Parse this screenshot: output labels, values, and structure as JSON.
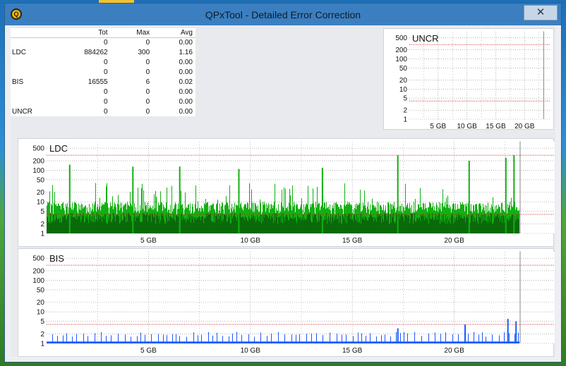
{
  "window": {
    "title": "QPxTool - Detailed Error Correction",
    "close_glyph": "✕",
    "icon_letter": "Q"
  },
  "stats": {
    "headers": [
      "",
      "Tot",
      "Max",
      "Avg"
    ],
    "rows": [
      [
        "",
        "0",
        "0",
        "0.00"
      ],
      [
        "LDC",
        "884262",
        "300",
        "1.16"
      ],
      [
        "",
        "0",
        "0",
        "0.00"
      ],
      [
        "",
        "0",
        "0",
        "0.00"
      ],
      [
        "BIS",
        "16555",
        "6",
        "0.02"
      ],
      [
        "",
        "0",
        "0",
        "0.00"
      ],
      [
        "",
        "0",
        "0",
        "0.00"
      ],
      [
        "UNCR",
        "0",
        "0",
        "0.00"
      ]
    ]
  },
  "chart_data": [
    {
      "type": "bar",
      "title": "UNCR",
      "y_scale": "log",
      "y_ticks": [
        "500",
        "200",
        "100",
        "50",
        "20",
        "10",
        "5",
        "2",
        "1"
      ],
      "x_ticks": [
        "5 GB",
        "10 GB",
        "15 GB",
        "20 GB"
      ],
      "x_range": [
        0,
        23.2
      ],
      "threshold_lines": [
        300,
        4
      ],
      "grid": true,
      "values": []
    },
    {
      "type": "bar",
      "title": "LDC",
      "y_scale": "log",
      "y_ticks": [
        "500",
        "200",
        "100",
        "50",
        "20",
        "10",
        "5",
        "2",
        "1"
      ],
      "x_ticks": [
        "5 GB",
        "10 GB",
        "15 GB",
        "20 GB"
      ],
      "x_range": [
        0,
        23.2
      ],
      "threshold_lines": [
        300,
        4
      ],
      "grid": true,
      "series": [
        {
          "name": "LDC",
          "color": "#12b012"
        }
      ],
      "peaks": [
        {
          "x": 1.1,
          "y": 150
        },
        {
          "x": 4.2,
          "y": 130
        },
        {
          "x": 6.5,
          "y": 130
        },
        {
          "x": 9.4,
          "y": 110
        },
        {
          "x": 13.5,
          "y": 120
        },
        {
          "x": 17.2,
          "y": 300
        },
        {
          "x": 20.7,
          "y": 200
        },
        {
          "x": 22.5,
          "y": 250
        },
        {
          "x": 22.9,
          "y": 300
        }
      ]
    },
    {
      "type": "bar",
      "title": "BIS",
      "y_scale": "log",
      "y_ticks": [
        "500",
        "200",
        "100",
        "50",
        "20",
        "10",
        "5",
        "2",
        "1"
      ],
      "x_ticks": [
        "5 GB",
        "10 GB",
        "15 GB",
        "20 GB"
      ],
      "x_range": [
        0,
        23.2
      ],
      "threshold_lines": [
        300,
        4
      ],
      "grid": true,
      "series": [
        {
          "name": "BIS",
          "color": "#1a5aff"
        }
      ],
      "peaks": [
        {
          "x": 17.2,
          "y": 3
        },
        {
          "x": 20.5,
          "y": 4
        },
        {
          "x": 22.6,
          "y": 6
        },
        {
          "x": 23.0,
          "y": 5
        }
      ]
    }
  ],
  "colors": {
    "titlebar": "#3b7fc0",
    "ldc_bar": "#12b012",
    "ldc_dark": "#0a6a0a",
    "bis_bar": "#1a5aff",
    "threshold": "#cc2222",
    "grid": "#888888"
  }
}
